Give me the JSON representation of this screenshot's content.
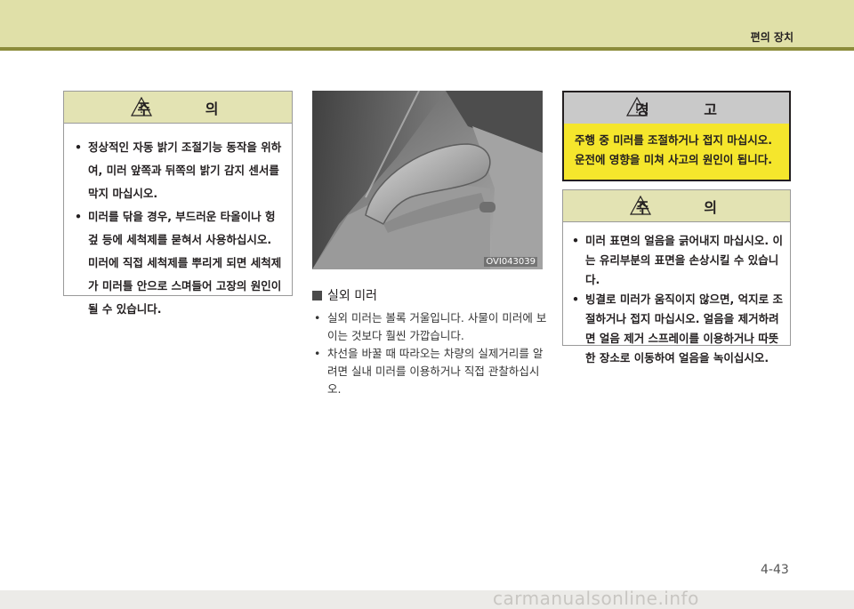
{
  "header": {
    "section_title": "편의 장치"
  },
  "caution_box_1": {
    "title": "주 의",
    "items": [
      "정상적인 자동 밝기 조절기능 동작을 위하여, 미러 앞쪽과 뒤쪽의 밝기 감지 센서를 막지 마십시오.",
      "미러를 닦을 경우, 부드러운 타올이나 헝겊 등에 세척제를 묻혀서 사용하십시오. 미러에 직접 세척제를 뿌리게 되면 세척제가 미러틀 안으로 스며들어 고장의 원인이 될 수 있습니다."
    ]
  },
  "photo": {
    "code": "OVI043039"
  },
  "outside_mirror": {
    "title": "실외 미러",
    "items": [
      "실외 미러는 볼록 거울입니다. 사물이 미러에 보이는 것보다 훨씬 가깝습니다.",
      "차선을 바꿀 때 따라오는 차량의 실제거리를 알려면 실내 미러를 이용하거나 직접 관찰하십시오."
    ]
  },
  "warning_box": {
    "title": "경 고",
    "text": "주행 중 미러를 조절하거나 접지 마십시오. 운전에 영향을 미쳐 사고의 원인이 됩니다."
  },
  "caution_box_2": {
    "title": "주 의",
    "items": [
      "미러 표면의 얼음을 긁어내지 마십시오. 이는 유리부분의 표면을 손상시킬 수 있습니다.",
      "빙결로 미러가 움직이지 않으면, 억지로 조절하거나 접지 마십시오. 얼음을 제거하려면 얼음 제거 스프레이를 이용하거나 따뜻한 장소로 이동하여 얼음을 녹이십시오."
    ]
  },
  "footer": {
    "page_number": "4-43",
    "watermark": "carmanualsonline.info"
  },
  "colors": {
    "header_band": "#e0e0a8",
    "header_line": "#8c8c3a",
    "caution_header": "#e3e3b3",
    "warning_header": "#c9c9c9",
    "warning_body": "#f5e62c"
  },
  "icons": [
    "warning-triangle-icon",
    "square-bullet-icon"
  ]
}
